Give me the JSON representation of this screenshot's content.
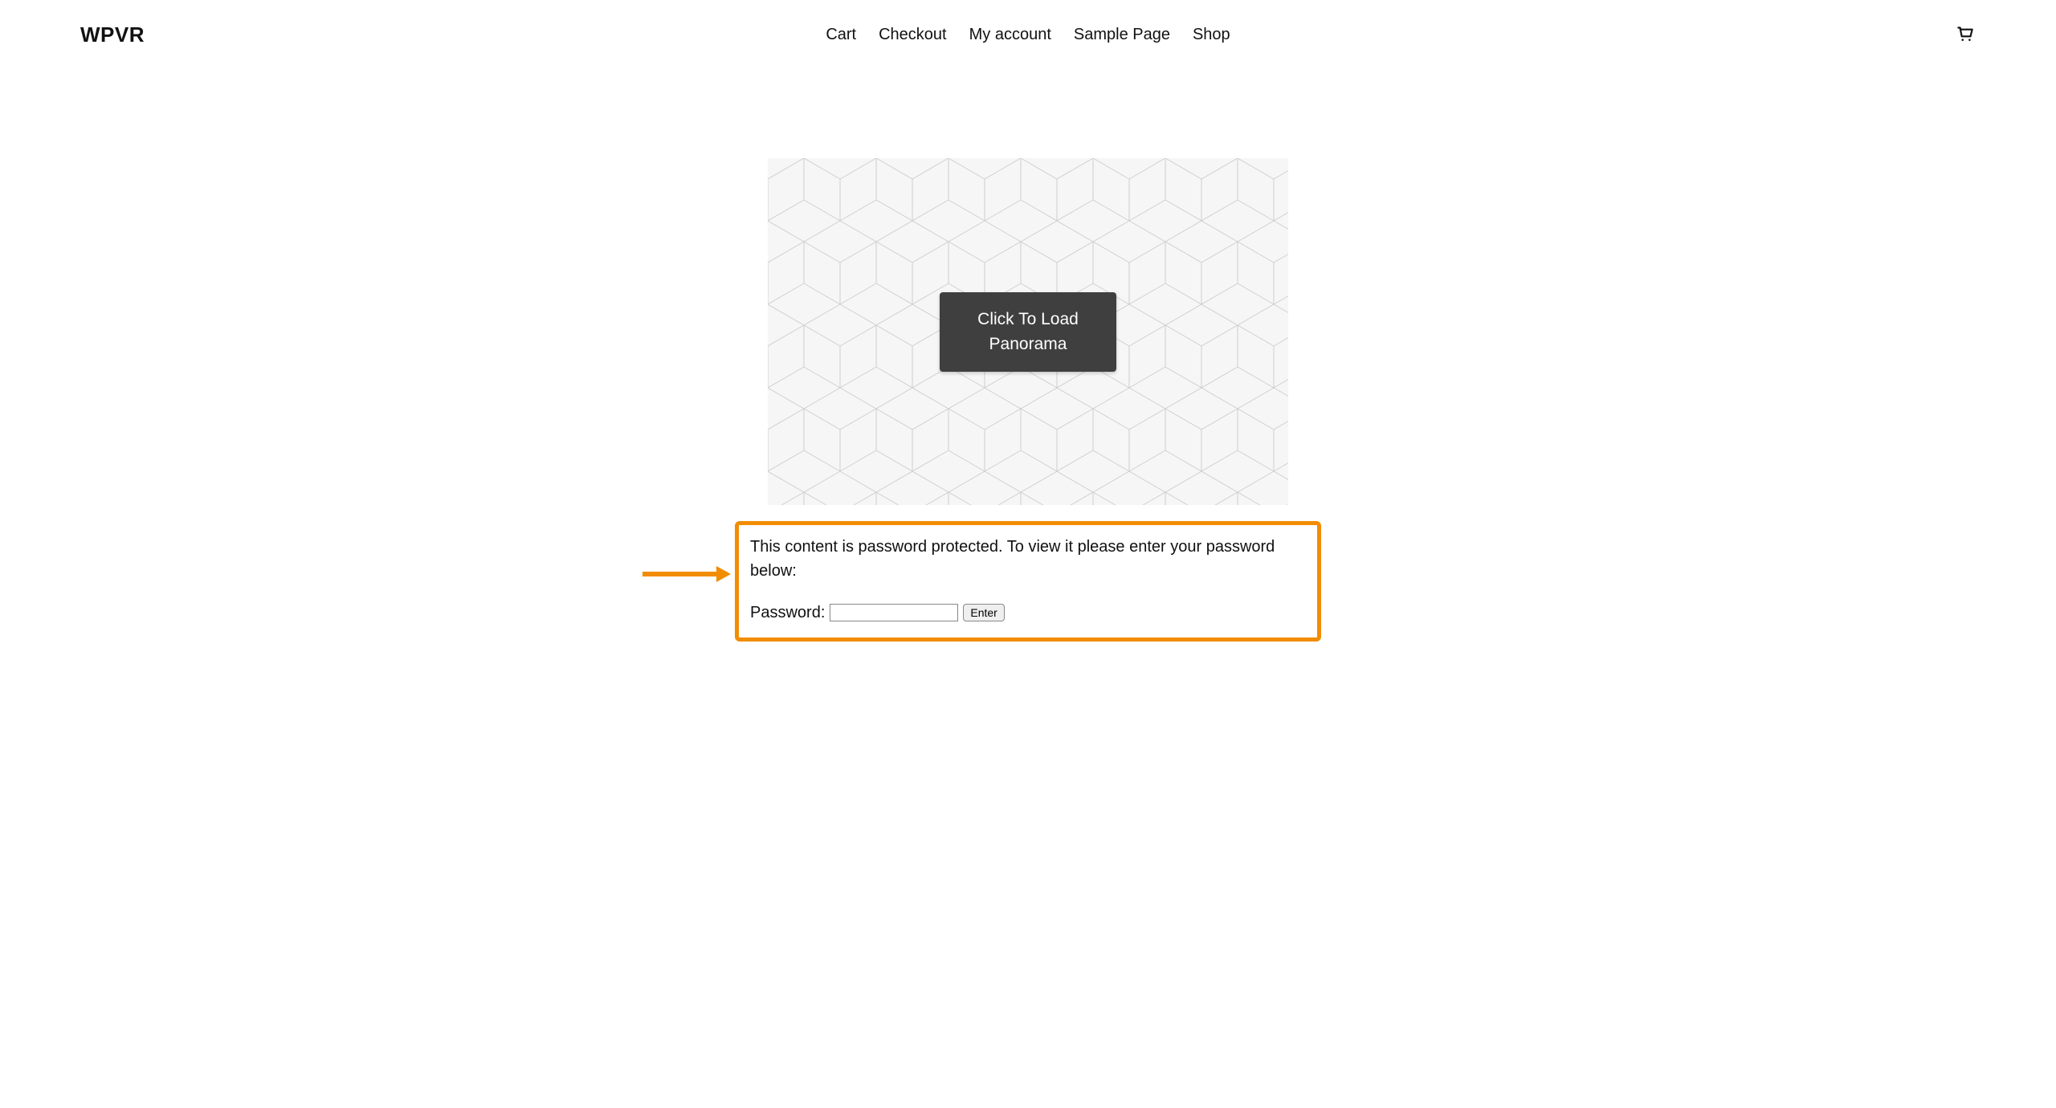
{
  "site": {
    "title": "WPVR"
  },
  "nav": {
    "items": [
      {
        "label": "Cart"
      },
      {
        "label": "Checkout"
      },
      {
        "label": "My account"
      },
      {
        "label": "Sample Page"
      },
      {
        "label": "Shop"
      }
    ]
  },
  "panorama": {
    "load_label": "Click To Load Panorama"
  },
  "protected": {
    "message": "This content is password protected. To view it please enter your password below:",
    "password_label": "Password:",
    "enter_label": "Enter",
    "password_value": ""
  },
  "icons": {
    "cart": "cart-icon"
  },
  "colors": {
    "highlight": "#f28c00",
    "panorama_btn_bg": "#3f3f3f"
  }
}
